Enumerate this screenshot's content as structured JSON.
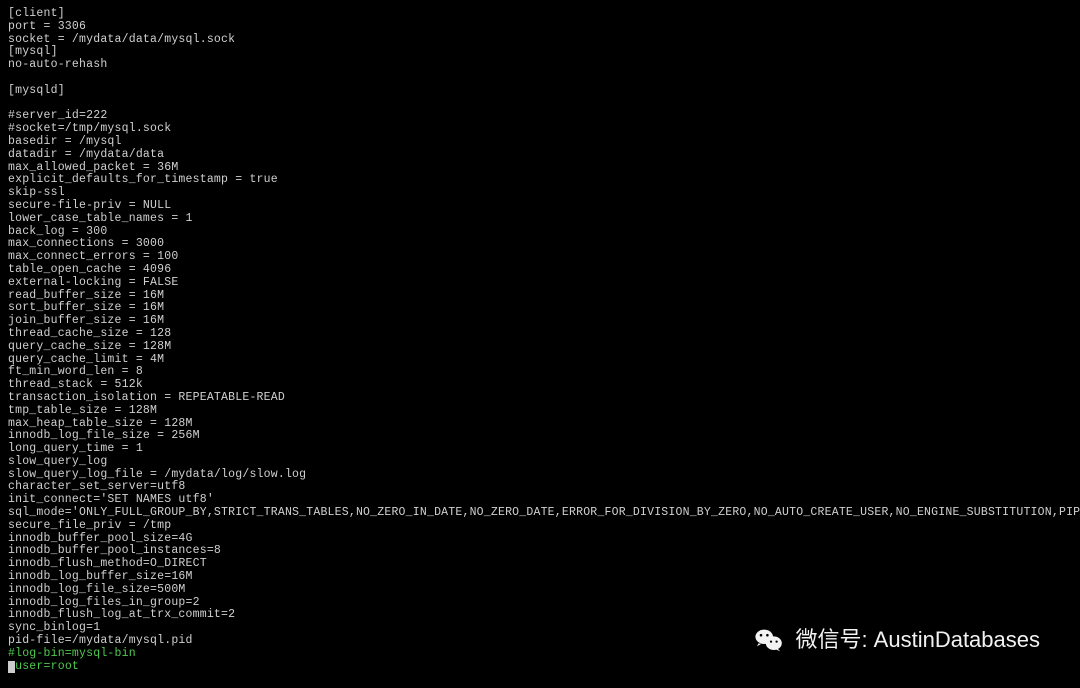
{
  "config": {
    "lines": [
      {
        "text": "[client]",
        "style": ""
      },
      {
        "text": "port = 3306",
        "style": ""
      },
      {
        "text": "socket = /mydata/data/mysql.sock",
        "style": ""
      },
      {
        "text": "[mysql]",
        "style": ""
      },
      {
        "text": "no-auto-rehash",
        "style": ""
      },
      {
        "text": "",
        "style": "empty"
      },
      {
        "text": "[mysqld]",
        "style": ""
      },
      {
        "text": "",
        "style": "empty"
      },
      {
        "text": "#server_id=222",
        "style": ""
      },
      {
        "text": "#socket=/tmp/mysql.sock",
        "style": ""
      },
      {
        "text": "basedir = /mysql",
        "style": ""
      },
      {
        "text": "datadir = /mydata/data",
        "style": ""
      },
      {
        "text": "max_allowed_packet = 36M",
        "style": ""
      },
      {
        "text": "explicit_defaults_for_timestamp = true",
        "style": ""
      },
      {
        "text": "skip-ssl",
        "style": ""
      },
      {
        "text": "secure-file-priv = NULL",
        "style": ""
      },
      {
        "text": "lower_case_table_names = 1",
        "style": ""
      },
      {
        "text": "back_log = 300",
        "style": ""
      },
      {
        "text": "max_connections = 3000",
        "style": ""
      },
      {
        "text": "max_connect_errors = 100",
        "style": ""
      },
      {
        "text": "table_open_cache = 4096",
        "style": ""
      },
      {
        "text": "external-locking = FALSE",
        "style": ""
      },
      {
        "text": "read_buffer_size = 16M",
        "style": ""
      },
      {
        "text": "sort_buffer_size = 16M",
        "style": ""
      },
      {
        "text": "join_buffer_size = 16M",
        "style": ""
      },
      {
        "text": "thread_cache_size = 128",
        "style": ""
      },
      {
        "text": "query_cache_size = 128M",
        "style": ""
      },
      {
        "text": "query_cache_limit = 4M",
        "style": ""
      },
      {
        "text": "ft_min_word_len = 8",
        "style": ""
      },
      {
        "text": "thread_stack = 512k",
        "style": ""
      },
      {
        "text": "transaction_isolation = REPEATABLE-READ",
        "style": ""
      },
      {
        "text": "tmp_table_size = 128M",
        "style": ""
      },
      {
        "text": "max_heap_table_size = 128M",
        "style": ""
      },
      {
        "text": "innodb_log_file_size = 256M",
        "style": ""
      },
      {
        "text": "long_query_time = 1",
        "style": ""
      },
      {
        "text": "slow_query_log",
        "style": ""
      },
      {
        "text": "slow_query_log_file = /mydata/log/slow.log",
        "style": ""
      },
      {
        "text": "character_set_server=utf8",
        "style": ""
      },
      {
        "text": "init_connect='SET NAMES utf8'",
        "style": ""
      },
      {
        "text": "sql_mode='ONLY_FULL_GROUP_BY,STRICT_TRANS_TABLES,NO_ZERO_IN_DATE,NO_ZERO_DATE,ERROR_FOR_DIVISION_BY_ZERO,NO_AUTO_CREATE_USER,NO_ENGINE_SUBSTITUTION,PIPES_AS_CONCAT,ANSI_QUOTES'",
        "style": ""
      },
      {
        "text": "secure_file_priv = /tmp",
        "style": ""
      },
      {
        "text": "innodb_buffer_pool_size=4G",
        "style": ""
      },
      {
        "text": "innodb_buffer_pool_instances=8",
        "style": ""
      },
      {
        "text": "innodb_flush_method=O_DIRECT",
        "style": ""
      },
      {
        "text": "innodb_log_buffer_size=16M",
        "style": ""
      },
      {
        "text": "innodb_log_file_size=500M",
        "style": ""
      },
      {
        "text": "innodb_log_files_in_group=2",
        "style": ""
      },
      {
        "text": "innodb_flush_log_at_trx_commit=2",
        "style": ""
      },
      {
        "text": "sync_binlog=1",
        "style": ""
      },
      {
        "text": "pid-file=/mydata/mysql.pid",
        "style": ""
      },
      {
        "text": "#log-bin=mysql-bin",
        "style": "green"
      },
      {
        "text": "#user=root",
        "style": "cursor"
      }
    ]
  },
  "watermark": {
    "label": "微信号: AustinDatabases"
  }
}
